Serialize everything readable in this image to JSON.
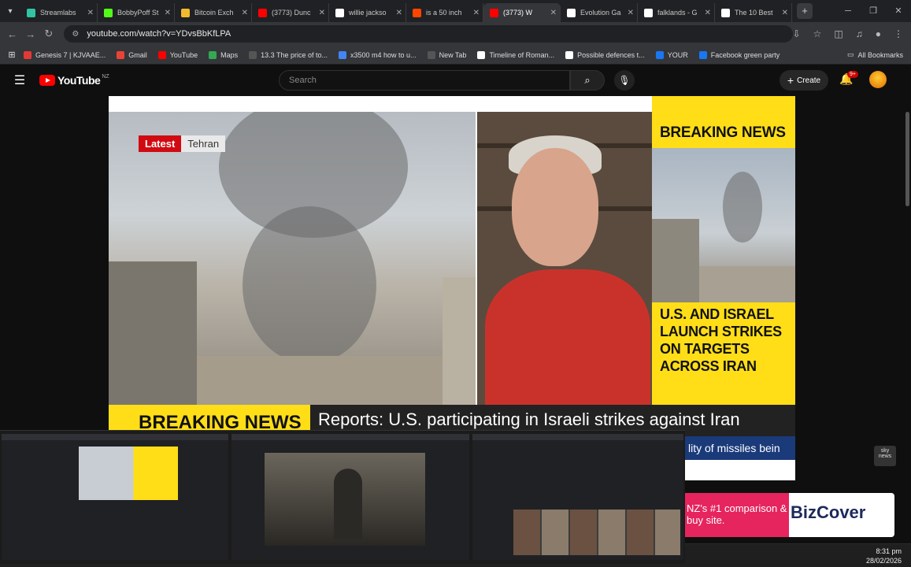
{
  "browser": {
    "tabs": [
      {
        "title": "Streamlabs",
        "color": "#31c3a2",
        "active": false
      },
      {
        "title": "BobbyPoff St",
        "color": "#53fc18",
        "active": false
      },
      {
        "title": "Bitcoin Exch",
        "color": "#f3ba2f",
        "active": false
      },
      {
        "title": "(3773) Dunc",
        "color": "#ff0000",
        "active": false
      },
      {
        "title": "willie jackso",
        "color": "#ffffff",
        "active": false
      },
      {
        "title": "is a 50 inch",
        "color": "#ff4500",
        "active": false
      },
      {
        "title": "(3773) W",
        "color": "#ff0000",
        "active": true
      },
      {
        "title": "Evolution Ga",
        "color": "#ffffff",
        "active": false
      },
      {
        "title": "falklands - G",
        "color": "#ffffff",
        "active": false
      },
      {
        "title": "The 10 Best",
        "color": "#ffffff",
        "active": false
      }
    ],
    "new_tab_label": "+",
    "url": "youtube.com/watch?v=YDvsBbKfLPA",
    "bookmarks": [
      {
        "label": "Genesis 7 | KJVAAE...",
        "color": "#e53935"
      },
      {
        "label": "Gmail",
        "color": "#ea4335"
      },
      {
        "label": "YouTube",
        "color": "#ff0000"
      },
      {
        "label": "Maps",
        "color": "#34a853"
      },
      {
        "label": "13.3 The price of to...",
        "color": "#555555"
      },
      {
        "label": "x3500 m4 how to u...",
        "color": "#4285f4"
      },
      {
        "label": "New Tab",
        "color": "#555555"
      },
      {
        "label": "Timeline of Roman...",
        "color": "#ffffff"
      },
      {
        "label": "Possible defences t...",
        "color": "#ffffff"
      },
      {
        "label": "YOUR",
        "color": "#1877f2"
      },
      {
        "label": "Facebook green party",
        "color": "#1877f2"
      }
    ],
    "all_bookmarks_label": "All Bookmarks"
  },
  "youtube": {
    "logo_text": "YouTube",
    "country_code": "NZ",
    "search_placeholder": "Search",
    "create_label": "Create",
    "notification_badge": "9+"
  },
  "video": {
    "latest_label": "Latest",
    "location_label": "Tehran",
    "breaking_header": "BREAKING NEWS",
    "headline": "U.S. AND ISRAEL LAUNCH STRIKES ON TARGETS ACROSS IRAN",
    "ticker_tag": "BREAKING NEWS",
    "ticker_text": "Reports: U.S. participating in Israeli strikes against Iran",
    "sub_ticker": "lity of missiles bein",
    "channel_logo": "sky news"
  },
  "ad": {
    "tagline": "NZ's #1 comparison & buy site.",
    "brand": "BizCover"
  },
  "taskbar": {
    "time": "8:31 pm",
    "date": "28/02/2026"
  }
}
